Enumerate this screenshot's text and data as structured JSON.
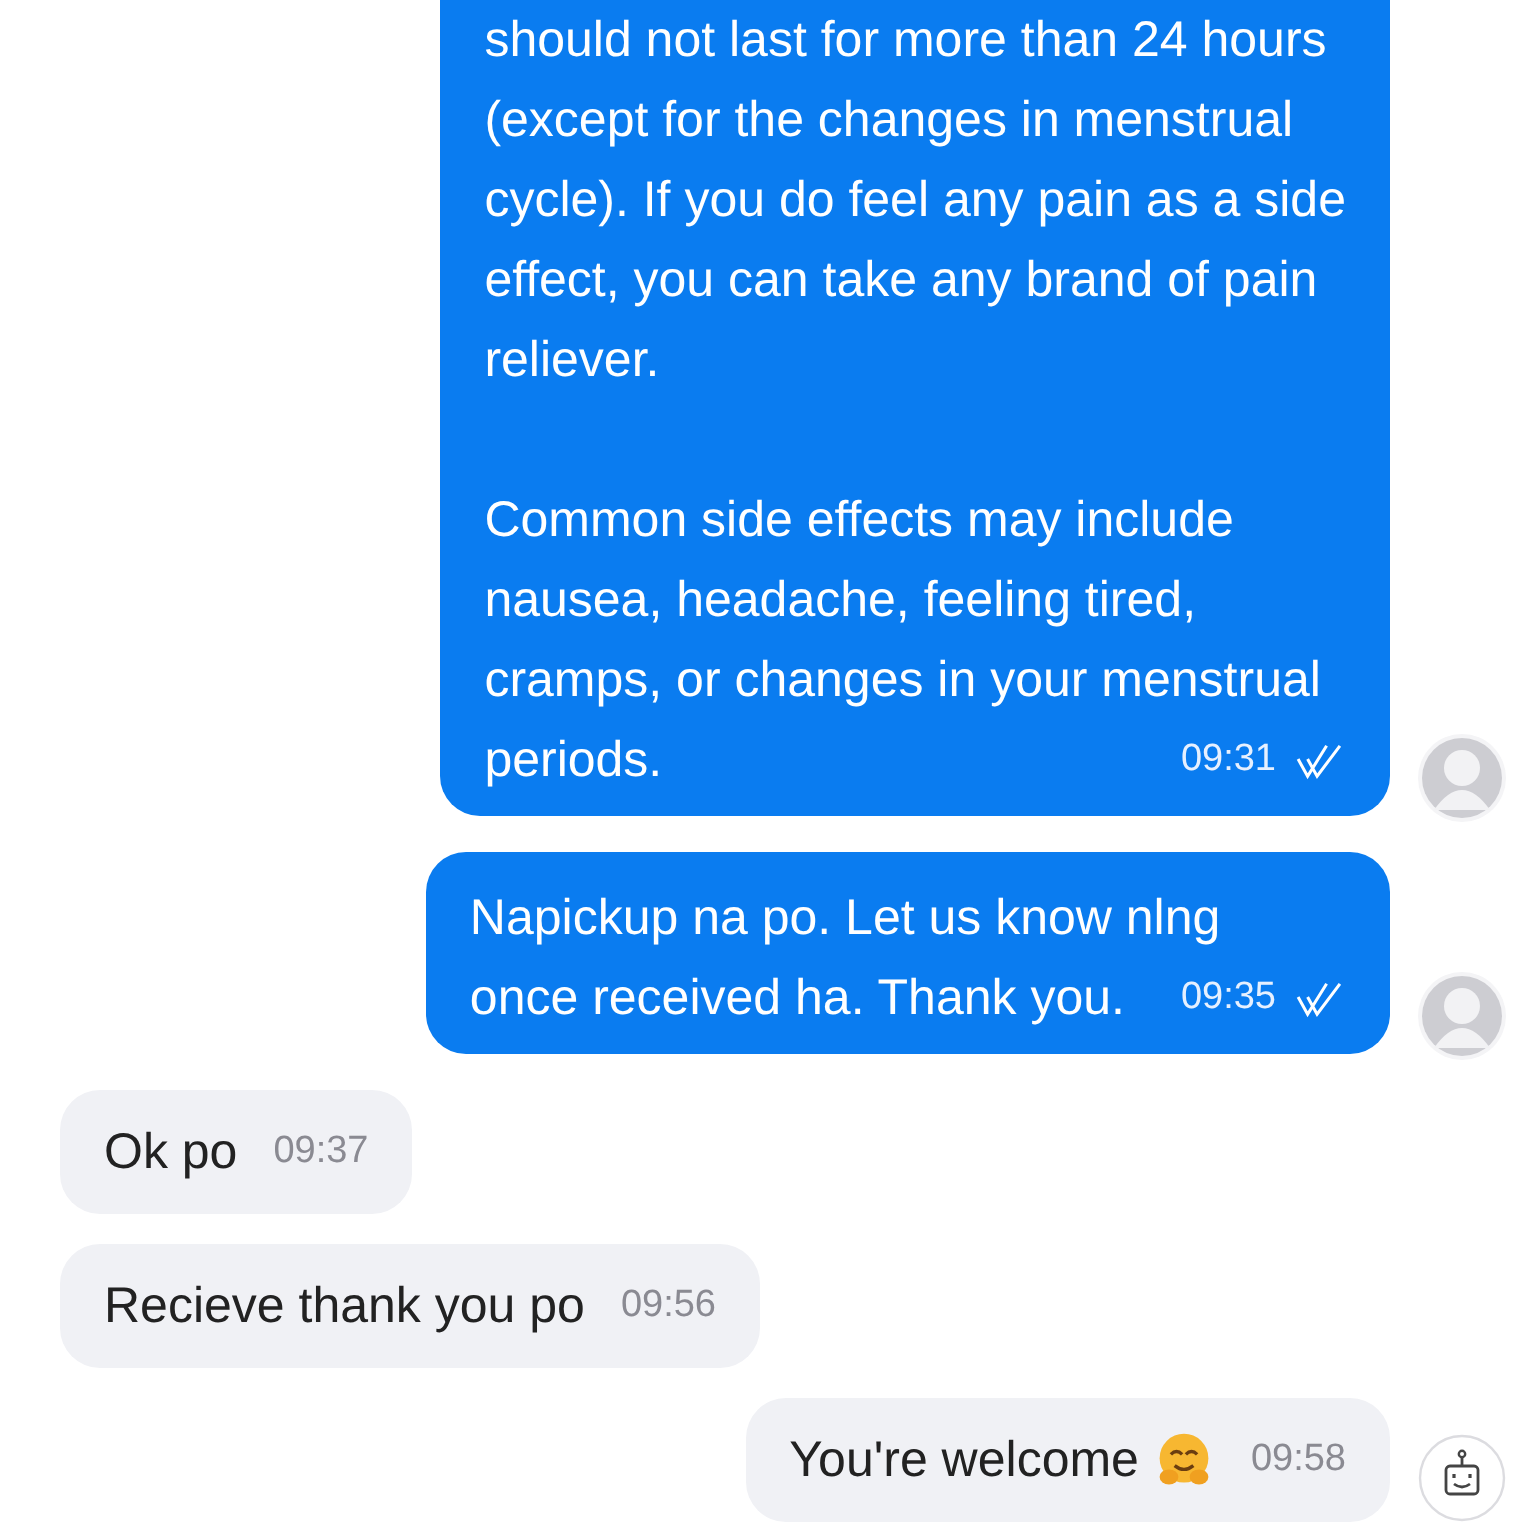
{
  "messages": [
    {
      "kind": "sent",
      "avatar": {
        "kind": "person"
      },
      "paragraphs": [
        [
          "should not last for more than 24 hours",
          "(except for the changes in menstrual",
          "cycle). If you do feel any pain as a side",
          "effect, you can take any brand of pain",
          "reliever."
        ],
        [
          "Common side effects may include",
          "nausea, headache, feeling tired,",
          "cramps, or changes in your menstrual",
          "periods."
        ]
      ],
      "time": "09:31",
      "read": true,
      "has_emoji": false
    },
    {
      "kind": "sent",
      "avatar": {
        "kind": "person"
      },
      "paragraphs": [
        [
          "Napickup na po. Let us know nlng",
          "once received ha. Thank you."
        ]
      ],
      "time": "09:35",
      "read": true,
      "has_emoji": false
    },
    {
      "kind": "received",
      "paragraphs": [
        [
          "Ok po"
        ]
      ],
      "time": "09:37",
      "has_emoji": false
    },
    {
      "kind": "received",
      "paragraphs": [
        [
          "Recieve thank you po"
        ]
      ],
      "time": "09:56",
      "has_emoji": false
    },
    {
      "kind": "auto",
      "avatar": {
        "kind": "bot"
      },
      "paragraphs": [
        [
          "You're welcome"
        ]
      ],
      "time": "09:58",
      "has_emoji": true
    }
  ]
}
